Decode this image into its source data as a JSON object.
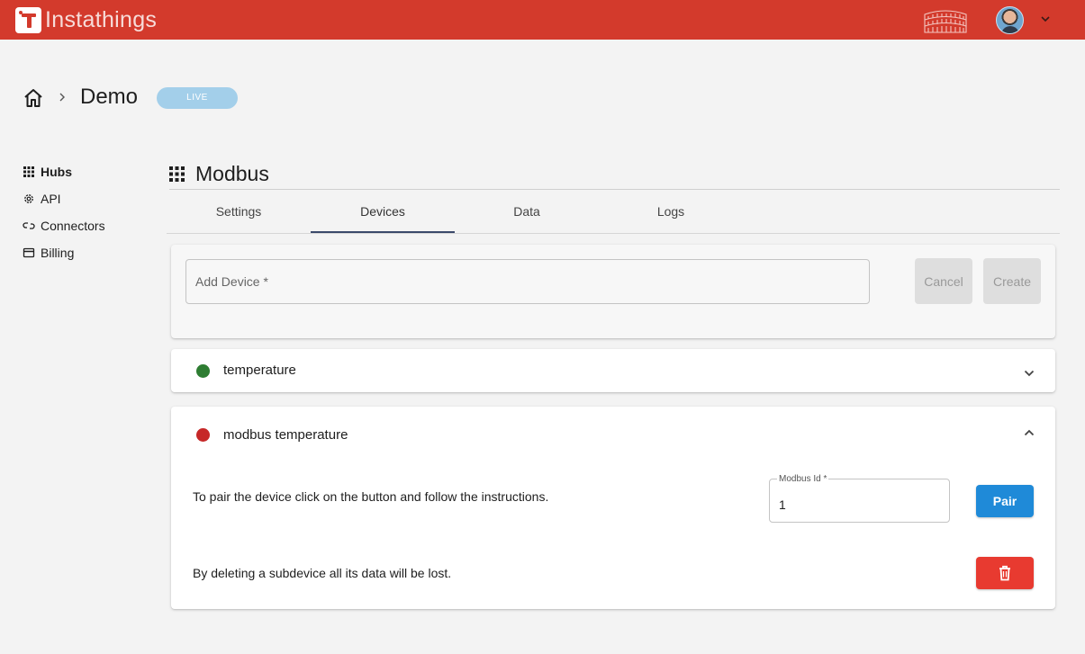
{
  "app": {
    "name": "Instathings"
  },
  "breadcrumb": {
    "current": "Demo",
    "status_badge": "LIVE"
  },
  "sidebar": {
    "items": [
      {
        "label": "Hubs",
        "icon": "grid-icon",
        "active": true
      },
      {
        "label": "API",
        "icon": "gear-icon",
        "active": false
      },
      {
        "label": "Connectors",
        "icon": "link-icon",
        "active": false
      },
      {
        "label": "Billing",
        "icon": "card-icon",
        "active": false
      }
    ]
  },
  "hub": {
    "title": "Modbus",
    "tabs": [
      {
        "label": "Settings",
        "active": false
      },
      {
        "label": "Devices",
        "active": true
      },
      {
        "label": "Data",
        "active": false
      },
      {
        "label": "Logs",
        "active": false
      }
    ]
  },
  "add_device": {
    "placeholder": "Add Device *",
    "cancel_label": "Cancel",
    "create_label": "Create"
  },
  "devices": [
    {
      "name": "temperature",
      "status_color": "#2e7d32",
      "expanded": false
    },
    {
      "name": "modbus temperature",
      "status_color": "#c62828",
      "expanded": true,
      "pair_text": "To pair the device click on the button and follow the instructions.",
      "modbus_id_label": "Modbus Id *",
      "modbus_id_value": "1",
      "pair_label": "Pair",
      "delete_text": "By deleting a subdevice all its data will be lost."
    }
  ],
  "colors": {
    "topbar": "#d33a2c",
    "pair_button": "#1f8ad8",
    "delete_button": "#e83a30",
    "live_badge": "#a3cfea"
  }
}
